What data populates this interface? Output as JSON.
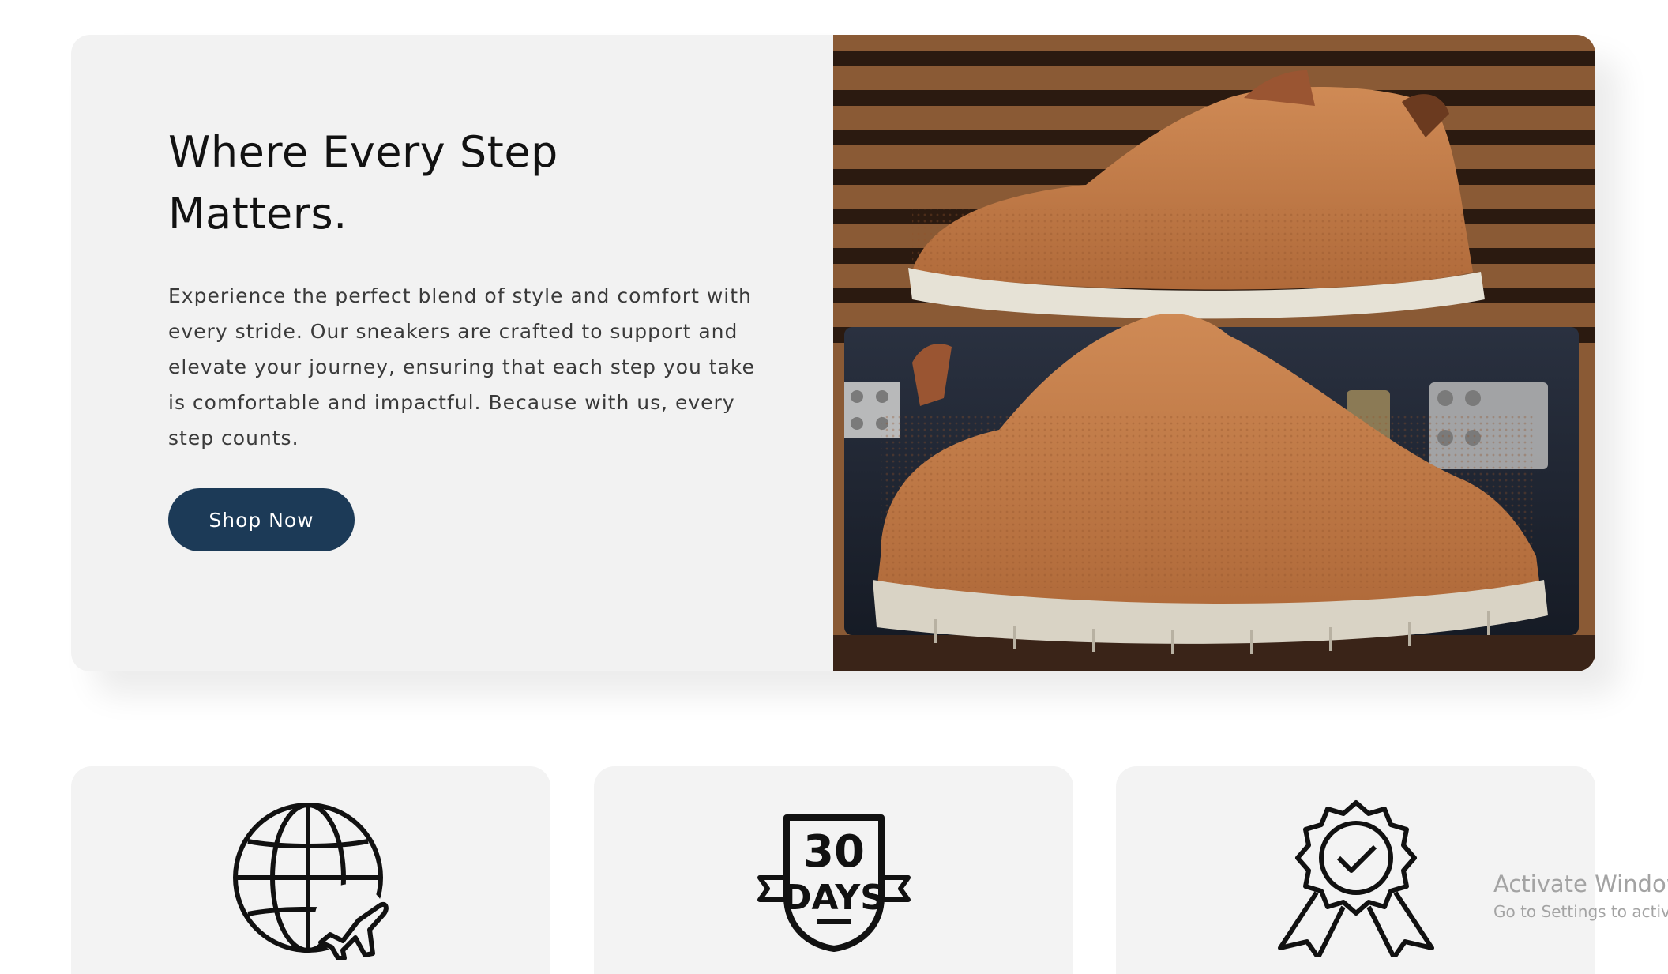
{
  "hero": {
    "title_line1": "Where Every Step",
    "title_line2": "Matters.",
    "description": "Experience the perfect blend of style and comfort with every stride. Our sneakers are crafted to support and elevate your journey, ensuring that each step you take is comfortable and impactful. Because with us, every step counts.",
    "button_label": "Shop Now",
    "image_alt": "Two tan knit sneakers on a dark suitcase",
    "colors": {
      "button": "#1c3a57",
      "card_background": "#f2f2f2"
    }
  },
  "features": [
    {
      "icon": "globe-plane-icon",
      "label": ""
    },
    {
      "icon": "thirty-days-badge-icon",
      "badge_number": "30",
      "badge_text": "DAYS",
      "label": ""
    },
    {
      "icon": "quality-ribbon-check-icon",
      "label": ""
    }
  ],
  "os_watermark": {
    "title": "Activate Window",
    "subtitle": "Go to Settings to activa"
  }
}
